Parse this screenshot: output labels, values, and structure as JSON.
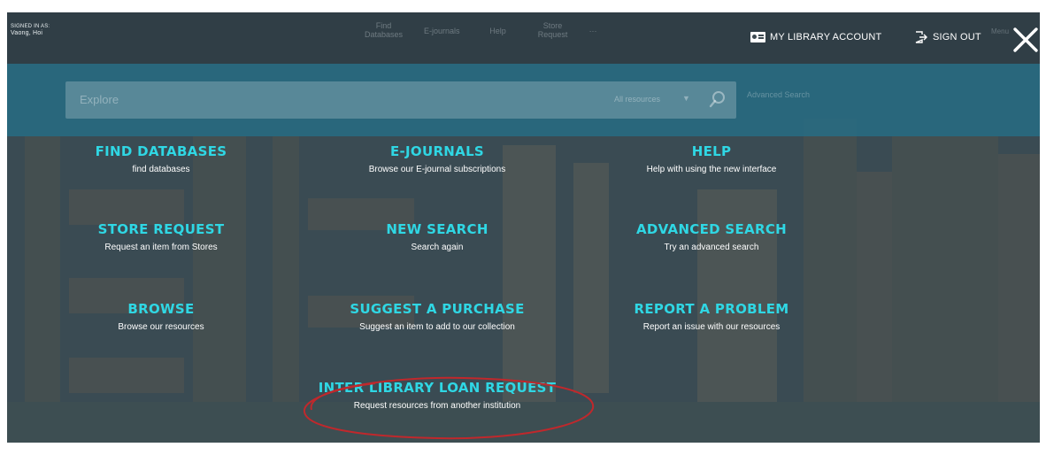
{
  "user": {
    "signed_in_label": "SIGNED IN AS:",
    "name": "Vaong, Hoi"
  },
  "top_nav": [
    {
      "line1": "Find",
      "line2": "Databases"
    },
    {
      "line1": "E-journals",
      "line2": ""
    },
    {
      "line1": "Help",
      "line2": ""
    },
    {
      "line1": "Store",
      "line2": "Request"
    },
    {
      "line1": "···",
      "line2": ""
    }
  ],
  "account": {
    "my_account_label": "MY LIBRARY ACCOUNT",
    "sign_out_label": "SIGN OUT",
    "menu_label": "Menu"
  },
  "search": {
    "placeholder": "Explore",
    "scope": "All resources",
    "advanced_label": "Advanced Search"
  },
  "menu": {
    "find_databases": {
      "title": "FIND DATABASES",
      "subtitle": "find databases"
    },
    "e_journals": {
      "title": "E-JOURNALS",
      "subtitle": "Browse our E-journal subscriptions"
    },
    "help": {
      "title": "HELP",
      "subtitle": "Help with using the new interface"
    },
    "store_request": {
      "title": "STORE REQUEST",
      "subtitle": "Request an item from Stores"
    },
    "new_search": {
      "title": "NEW SEARCH",
      "subtitle": "Search again"
    },
    "advanced_search": {
      "title": "ADVANCED SEARCH",
      "subtitle": "Try an advanced search"
    },
    "browse": {
      "title": "BROWSE",
      "subtitle": "Browse our resources"
    },
    "suggest_purchase": {
      "title": "SUGGEST A PURCHASE",
      "subtitle": "Suggest an item to add to our collection"
    },
    "report_problem": {
      "title": "REPORT A PROBLEM",
      "subtitle": "Report an issue with our resources"
    },
    "inter_library_loan": {
      "title": "INTER LIBRARY LOAN REQUEST",
      "subtitle": "Request resources from another institution"
    }
  },
  "colors": {
    "accent": "#2fd7e4",
    "search_band": "#266e87",
    "highlight_ellipse": "#c0282c"
  },
  "icons": {
    "account": "id-card-icon",
    "sign_out": "sign-out-icon",
    "close": "close-icon",
    "search": "search-icon"
  }
}
